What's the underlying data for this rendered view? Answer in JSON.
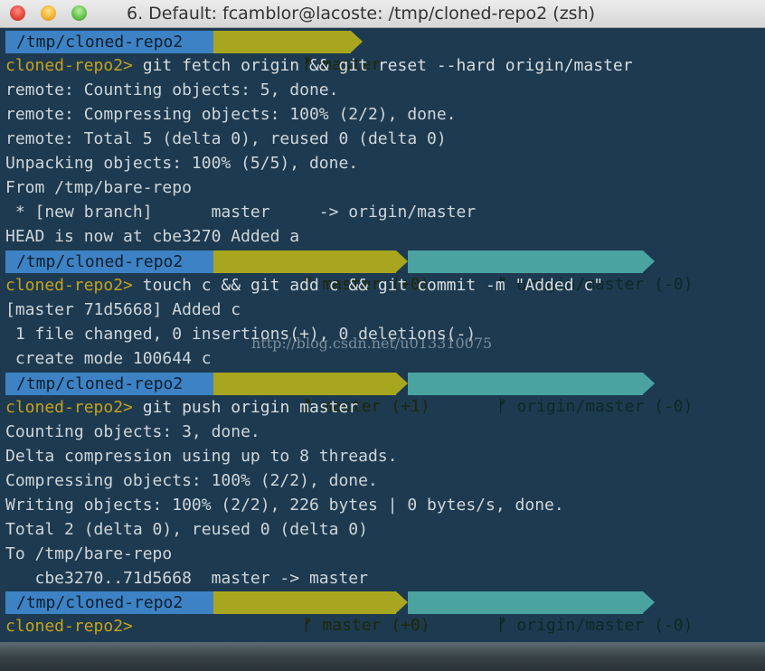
{
  "window": {
    "title": "6. Default: fcamblor@lacoste: /tmp/cloned-repo2 (zsh)"
  },
  "colors": {
    "path_segment": "#3d82c4",
    "branch_segment": "#a8a61e",
    "remote_segment": "#4aa3a0",
    "prompt": "#c7a21a"
  },
  "powerline": [
    {
      "path": "/tmp/cloned-repo2",
      "branch": "master",
      "remote": ""
    },
    {
      "path": "/tmp/cloned-repo2",
      "branch": "master (+0)",
      "remote": "origin/master (-0)"
    },
    {
      "path": "/tmp/cloned-repo2",
      "branch": "master (+1)",
      "remote": "origin/master (-0)"
    },
    {
      "path": "/tmp/cloned-repo2",
      "branch": "master (+0)",
      "remote": "origin/master (-0)"
    }
  ],
  "prompt": "cloned-repo2>",
  "commands": [
    "git fetch origin && git reset --hard origin/master",
    "touch c && git add c && git commit -m \"Added c\"",
    "git push origin master"
  ],
  "output": {
    "block1": [
      "remote: Counting objects: 5, done.",
      "remote: Compressing objects: 100% (2/2), done.",
      "remote: Total 5 (delta 0), reused 0 (delta 0)",
      "Unpacking objects: 100% (5/5), done.",
      "From /tmp/bare-repo",
      " * [new branch]      master     -> origin/master",
      "HEAD is now at cbe3270 Added a"
    ],
    "block2": [
      "[master 71d5668] Added c",
      " 1 file changed, 0 insertions(+), 0 deletions(-)",
      " create mode 100644 c"
    ],
    "block3": [
      "Counting objects: 3, done.",
      "Delta compression using up to 8 threads.",
      "Compressing objects: 100% (2/2), done.",
      "Writing objects: 100% (2/2), 226 bytes | 0 bytes/s, done.",
      "Total 2 (delta 0), reused 0 (delta 0)",
      "To /tmp/bare-repo",
      "   cbe3270..71d5668  master -> master"
    ]
  },
  "watermark": "http://blog.csdn.net/u013310075",
  "icons": {
    "branch": "branch-icon"
  }
}
